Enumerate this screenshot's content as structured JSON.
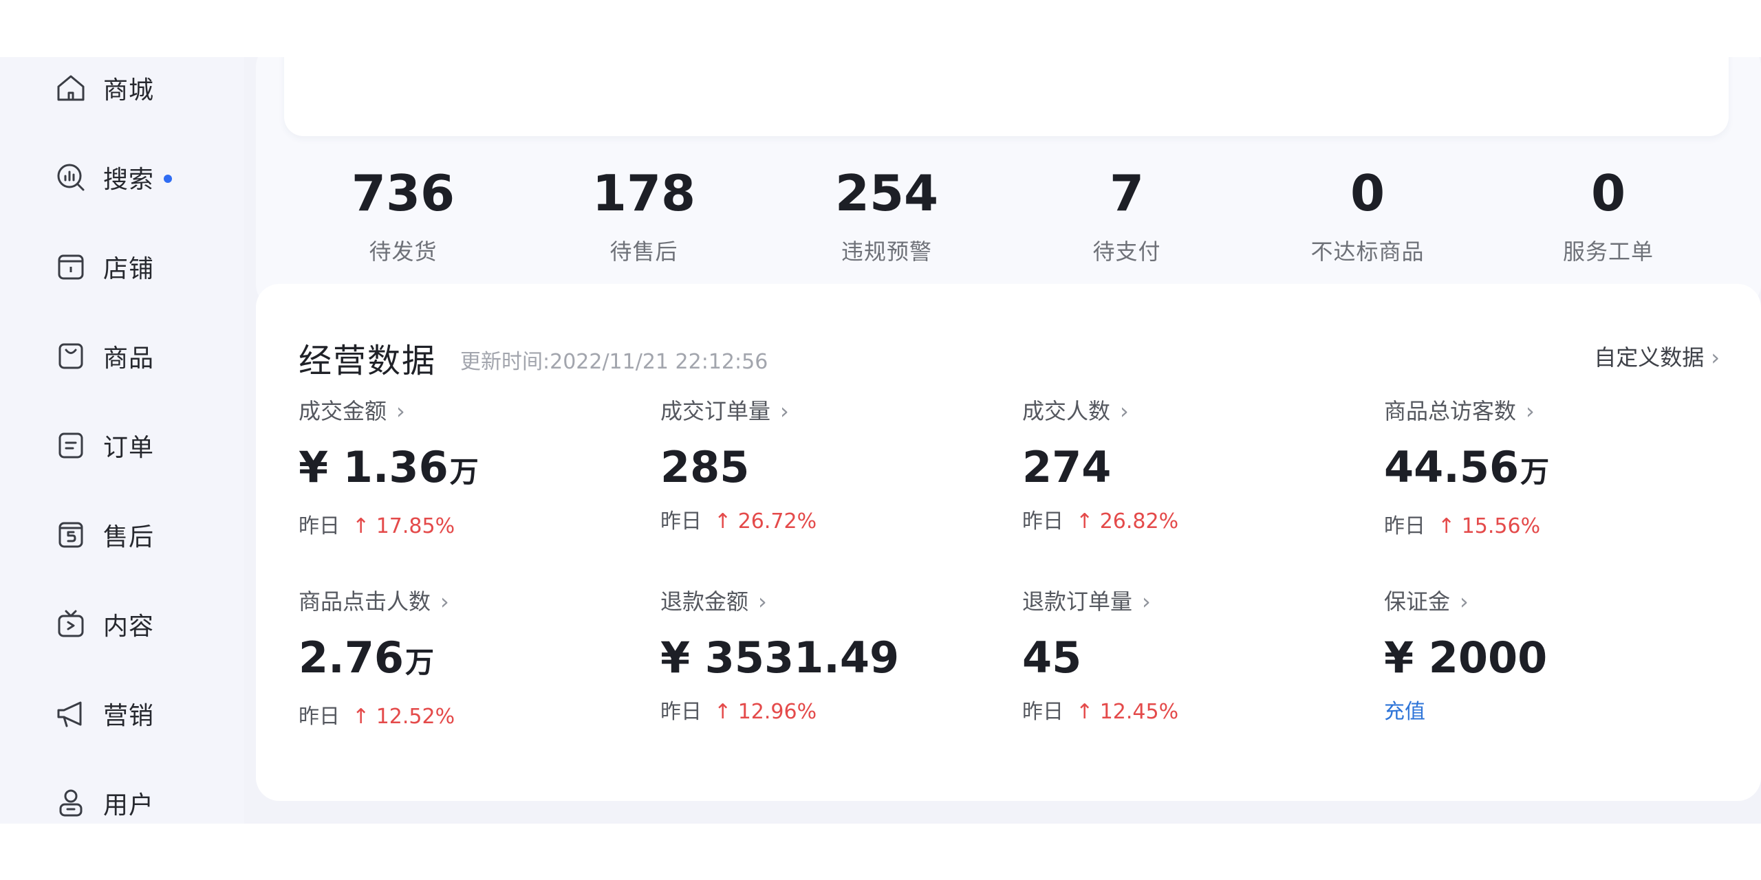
{
  "sidebar": {
    "items": [
      {
        "label": "商城",
        "icon": "home-icon"
      },
      {
        "label": "搜索",
        "icon": "search-icon",
        "dot": true
      },
      {
        "label": "店铺",
        "icon": "store-icon"
      },
      {
        "label": "商品",
        "icon": "product-bag-icon"
      },
      {
        "label": "订单",
        "icon": "order-list-icon"
      },
      {
        "label": "售后",
        "icon": "after-sales-icon"
      },
      {
        "label": "内容",
        "icon": "content-tv-icon"
      },
      {
        "label": "营销",
        "icon": "megaphone-icon"
      },
      {
        "label": "用户",
        "icon": "user-icon"
      }
    ],
    "dot_color": "#2f6cf3"
  },
  "stats": [
    {
      "value": "736",
      "label": "待发货"
    },
    {
      "value": "178",
      "label": "待售后"
    },
    {
      "value": "254",
      "label": "违规预警"
    },
    {
      "value": "7",
      "label": "待支付"
    },
    {
      "value": "0",
      "label": "不达标商品"
    },
    {
      "value": "0",
      "label": "服务工单"
    }
  ],
  "business": {
    "title": "经营数据",
    "updated": "更新时间:2022/11/21 22:12:56",
    "custom_link": "自定义数据",
    "chevron": "›",
    "yesterday_label": "昨日",
    "arrow_up": "↑",
    "metrics": [
      {
        "label": "成交金额",
        "prefix": "¥",
        "value": "1.36",
        "unit": "万",
        "change": "17.85%"
      },
      {
        "label": "成交订单量",
        "prefix": "",
        "value": "285",
        "unit": "",
        "change": "26.72%"
      },
      {
        "label": "成交人数",
        "prefix": "",
        "value": "274",
        "unit": "",
        "change": "26.82%"
      },
      {
        "label": "商品总访客数",
        "prefix": "",
        "value": "44.56",
        "unit": "万",
        "change": "15.56%"
      },
      {
        "label": "商品点击人数",
        "prefix": "",
        "value": "2.76",
        "unit": "万",
        "change": "12.52%"
      },
      {
        "label": "退款金额",
        "prefix": "¥",
        "value": "3531.49",
        "unit": "",
        "change": "12.96%"
      },
      {
        "label": "退款订单量",
        "prefix": "",
        "value": "45",
        "unit": "",
        "change": "12.45%"
      },
      {
        "label": "保证金",
        "prefix": "¥",
        "value": "2000",
        "unit": "",
        "link": "充值"
      }
    ]
  },
  "colors": {
    "accent_blue": "#2f6cf3",
    "increase_red": "#e44a4a",
    "link_blue": "#2d74d8"
  }
}
